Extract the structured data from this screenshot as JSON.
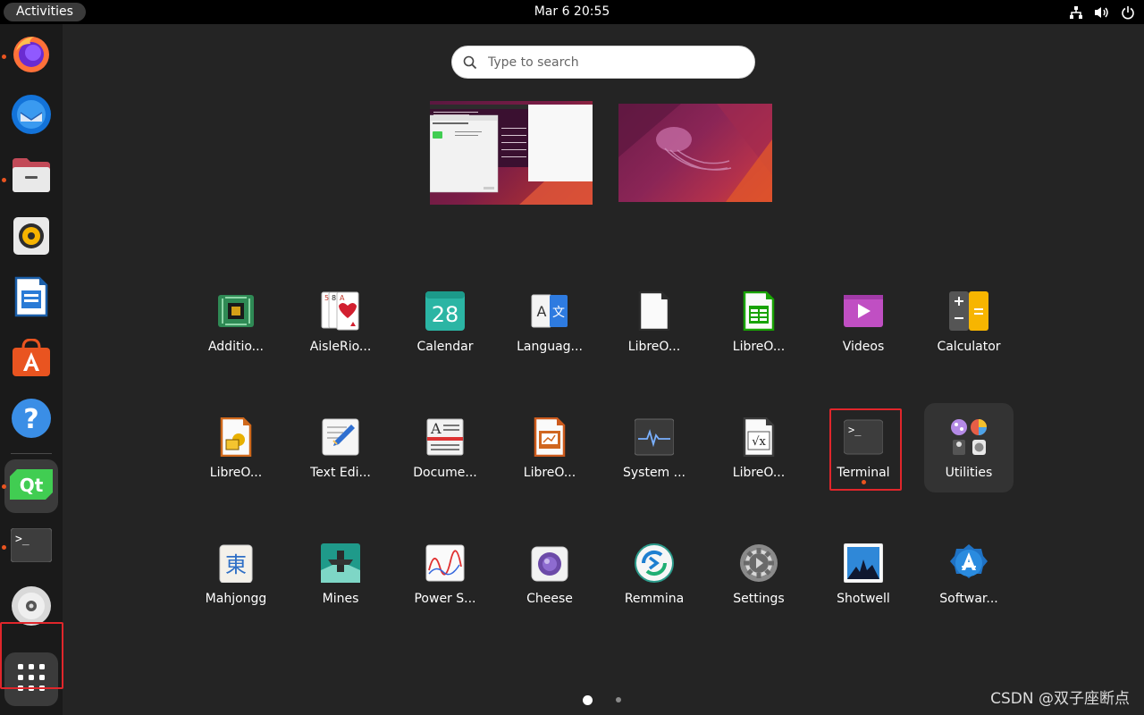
{
  "topbar": {
    "activities": "Activities",
    "datetime": "Mar 6  20:55"
  },
  "search": {
    "placeholder": "Type to search"
  },
  "apps": [
    {
      "label": "Additio...",
      "icon": "additional-drivers-icon"
    },
    {
      "label": "AisleRio...",
      "icon": "aisleriot-cards-icon"
    },
    {
      "label": "Calendar",
      "icon": "calendar-icon",
      "day": "28"
    },
    {
      "label": "Languag...",
      "icon": "language-support-icon",
      "latin": "A",
      "cjk": "文"
    },
    {
      "label": "LibreO...",
      "icon": "libreoffice-icon"
    },
    {
      "label": "LibreO...",
      "icon": "libreoffice-calc-icon"
    },
    {
      "label": "Videos",
      "icon": "videos-icon"
    },
    {
      "label": "Calculator",
      "icon": "calculator-icon"
    },
    {
      "label": "LibreO...",
      "icon": "libreoffice-impress-icon"
    },
    {
      "label": "Text Edi...",
      "icon": "text-editor-icon"
    },
    {
      "label": "Docume...",
      "icon": "document-viewer-icon",
      "letter": "A"
    },
    {
      "label": "LibreO...",
      "icon": "libreoffice-draw-icon"
    },
    {
      "label": "System ...",
      "icon": "system-monitor-icon"
    },
    {
      "label": "LibreO...",
      "icon": "libreoffice-math-icon",
      "glyph": "√x"
    },
    {
      "label": "Terminal",
      "icon": "terminal-icon",
      "prompt": ">_"
    },
    {
      "label": "Utilities",
      "icon": "utilities-folder-icon"
    },
    {
      "label": "Mahjongg",
      "icon": "mahjongg-icon",
      "glyph": "東"
    },
    {
      "label": "Mines",
      "icon": "mines-icon"
    },
    {
      "label": "Power S...",
      "icon": "power-statistics-icon"
    },
    {
      "label": "Cheese",
      "icon": "cheese-icon"
    },
    {
      "label": "Remmina",
      "icon": "remmina-icon"
    },
    {
      "label": "Settings",
      "icon": "settings-gear-icon"
    },
    {
      "label": "Shotwell",
      "icon": "shotwell-icon"
    },
    {
      "label": "Softwar...",
      "icon": "software-updater-icon"
    }
  ],
  "dock": [
    {
      "name": "firefox",
      "icon": "firefox-icon"
    },
    {
      "name": "thunderbird",
      "icon": "thunderbird-icon"
    },
    {
      "name": "files",
      "icon": "files-icon"
    },
    {
      "name": "rhythmbox",
      "icon": "rhythmbox-icon"
    },
    {
      "name": "libreoffice-writer",
      "icon": "writer-icon"
    },
    {
      "name": "app-center",
      "icon": "app-center-icon"
    },
    {
      "name": "help",
      "icon": "help-icon",
      "glyph": "?"
    },
    {
      "name": "qt-creator",
      "icon": "qt-icon",
      "glyph": "Qt"
    },
    {
      "name": "terminal",
      "icon": "terminal-icon",
      "glyph": ">_"
    },
    {
      "name": "dvd",
      "icon": "disc-icon"
    },
    {
      "name": "show-apps",
      "icon": "grid-icon"
    }
  ],
  "pages": {
    "count": 2,
    "current": 1
  },
  "watermark": "CSDN @双子座断点",
  "colors": {
    "accent": "#e95420",
    "highlight": "#e0262b",
    "background": "#242424"
  }
}
